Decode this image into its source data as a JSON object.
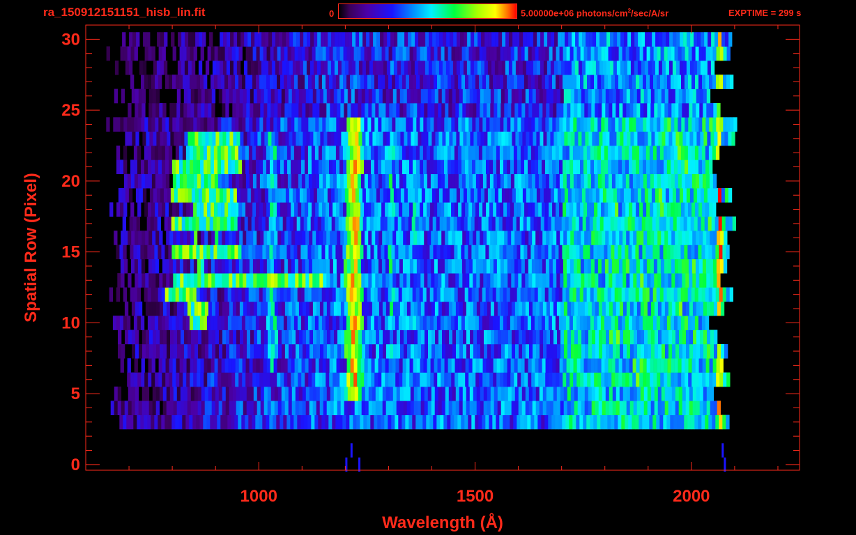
{
  "header": {
    "file_title": "ra_150912151151_hisb_lin.fit",
    "colorbar_min_label": "0",
    "colorbar_max_prefix": "5.00000e+06 photons/cm",
    "colorbar_max_exp": "2",
    "colorbar_max_suffix": "/sec/A/sr",
    "exptime": "EXPTIME = 299 s"
  },
  "colors": {
    "axis": "#ff2a1a",
    "background": "#000000",
    "colormap": [
      "#000000",
      "#3a0058",
      "#4b00a8",
      "#1a14ff",
      "#0090ff",
      "#00f0ff",
      "#00ff40",
      "#a8ff00",
      "#ffff00",
      "#ff7000",
      "#ff0000"
    ]
  },
  "chart_data": {
    "type": "heatmap",
    "title": "",
    "xlabel": "Wavelength (Å)",
    "ylabel": "Spatial Row (Pixel)",
    "xlim": [
      600,
      2250
    ],
    "ylim": [
      -0.4,
      31
    ],
    "x_major_ticks": [
      1000,
      1500,
      2000
    ],
    "x_tick_labels": [
      "1000",
      "1500",
      "2000"
    ],
    "x_minor_step": 100,
    "y_major_ticks": [
      0,
      5,
      10,
      15,
      20,
      25,
      30
    ],
    "y_tick_labels": [
      "0",
      "5",
      "10",
      "15",
      "20",
      "25",
      "30"
    ],
    "y_minor_step": 1,
    "grid": false,
    "colorbar_range": [
      0,
      5000000
    ],
    "colorbar_unit": "photons/cm^2/sec/A/sr",
    "data_extent": {
      "x": [
        670,
        2100
      ],
      "rows": [
        3,
        30
      ]
    },
    "features": [
      {
        "kind": "line",
        "center": 1216,
        "width": 20,
        "rows": [
          5,
          24
        ],
        "level": 0.85
      },
      {
        "kind": "line",
        "center": 1028,
        "width": 14,
        "rows": [
          7,
          23
        ],
        "level": 0.52
      },
      {
        "kind": "line",
        "center": 1302,
        "width": 12,
        "rows": [
          7,
          23
        ],
        "level": 0.5
      },
      {
        "kind": "line",
        "center": 1356,
        "width": 10,
        "rows": [
          7,
          23
        ],
        "level": 0.46
      },
      {
        "kind": "line",
        "center": 1465,
        "width": 10,
        "rows": [
          7,
          23
        ],
        "level": 0.42
      },
      {
        "kind": "band",
        "x": [
          1800,
          2060
        ],
        "rows": [
          6,
          24
        ],
        "level": 0.55
      },
      {
        "kind": "edge",
        "center": 2062,
        "width": 6,
        "rows": [
          2,
          30
        ],
        "level": 0.95
      },
      {
        "kind": "trace",
        "points": [
          [
            835,
            10.5
          ],
          [
            830,
            12
          ],
          [
            850,
            13
          ],
          [
            880,
            13
          ],
          [
            940,
            13
          ],
          [
            1000,
            13
          ],
          [
            1060,
            13
          ],
          [
            1100,
            13
          ]
        ],
        "width": 5,
        "level": 0.62
      },
      {
        "kind": "trace",
        "points": [
          [
            870,
            13
          ],
          [
            850,
            15
          ],
          [
            848,
            17
          ],
          [
            850,
            19
          ],
          [
            850,
            21
          ],
          [
            875,
            22.5
          ],
          [
            905,
            22.5
          ],
          [
            900,
            21
          ],
          [
            895,
            19
          ],
          [
            895,
            17
          ],
          [
            900,
            15
          ]
        ],
        "width": 5,
        "level": 0.6
      }
    ]
  }
}
